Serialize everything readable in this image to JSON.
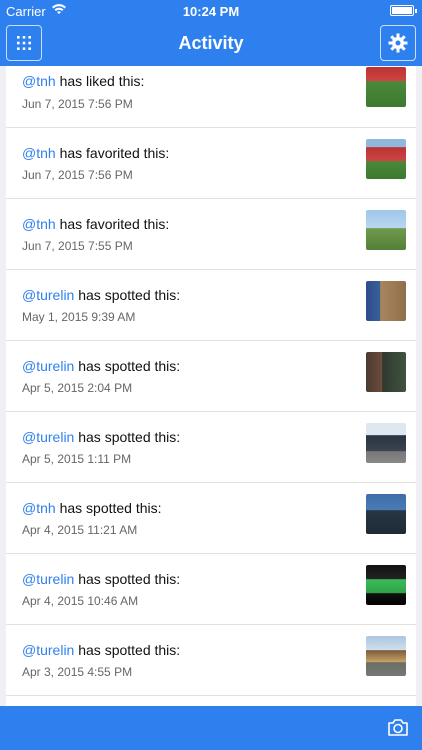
{
  "status": {
    "carrier": "Carrier",
    "time": "10:24 PM"
  },
  "nav": {
    "title": "Activity"
  },
  "icons": {
    "grid": "grid-icon",
    "settings": "gear-icon",
    "camera": "camera-icon"
  },
  "colors": {
    "accent": "#2f80ef"
  },
  "feed": [
    {
      "user": "@tnh",
      "action": "has liked this:",
      "date": "Jun 7, 2015 7:56 PM",
      "thumb": "stadium"
    },
    {
      "user": "@tnh",
      "action": "has favorited this:",
      "date": "Jun 7, 2015 7:56 PM",
      "thumb": "stadium"
    },
    {
      "user": "@tnh",
      "action": "has favorited this:",
      "date": "Jun 7, 2015 7:55 PM",
      "thumb": "field"
    },
    {
      "user": "@turelin",
      "action": "has spotted this:",
      "date": "May 1, 2015 9:39 AM",
      "thumb": "building"
    },
    {
      "user": "@turelin",
      "action": "has spotted this:",
      "date": "Apr 5, 2015 2:04 PM",
      "thumb": "storefront"
    },
    {
      "user": "@turelin",
      "action": "has spotted this:",
      "date": "Apr 5, 2015 1:11 PM",
      "thumb": "shop"
    },
    {
      "user": "@tnh",
      "action": "has spotted this:",
      "date": "Apr 4, 2015 11:21 AM",
      "thumb": "crowd"
    },
    {
      "user": "@turelin",
      "action": "has spotted this:",
      "date": "Apr 4, 2015 10:46 AM",
      "thumb": "screen"
    },
    {
      "user": "@turelin",
      "action": "has spotted this:",
      "date": "Apr 3, 2015 4:55 PM",
      "thumb": "market"
    }
  ]
}
